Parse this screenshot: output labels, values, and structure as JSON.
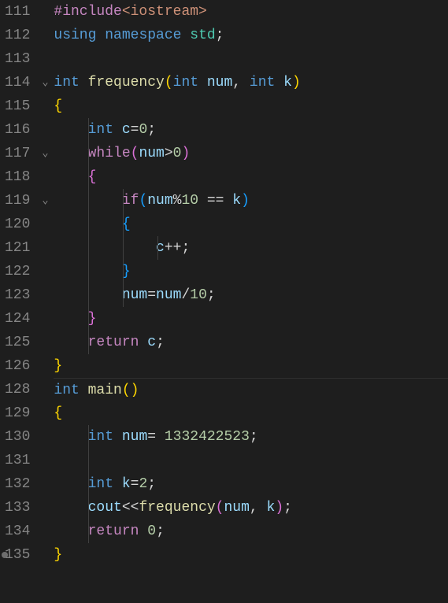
{
  "editor": {
    "language": "cpp",
    "colors": {
      "background": "#1e1e1e",
      "gutter_fg": "#858585",
      "default_fg": "#d4d4d4",
      "keyword": "#569cd6",
      "control": "#c586c0",
      "function": "#dcdcaa",
      "identifier": "#9cdcfe",
      "number": "#b5cea8",
      "type_namespace": "#4ec9b0",
      "bracket1": "#ffd700",
      "bracket2": "#da70d6",
      "bracket3": "#179fff"
    },
    "fold_markers": {
      "114": "v",
      "117": "v",
      "119": "v"
    },
    "breakpoint_hint_line": 135,
    "lines": [
      {
        "num": "111",
        "indent_guides": [],
        "tokens": [
          {
            "t": "#include",
            "c": "tk-pp"
          },
          {
            "t": "<iostream>",
            "c": "tk-str"
          }
        ]
      },
      {
        "num": "112",
        "indent_guides": [],
        "tokens": [
          {
            "t": "using",
            "c": "tk-kw"
          },
          {
            "t": " ",
            "c": "tk-wht"
          },
          {
            "t": "namespace",
            "c": "tk-kw"
          },
          {
            "t": " ",
            "c": "tk-wht"
          },
          {
            "t": "std",
            "c": "tk-ns"
          },
          {
            "t": ";",
            "c": "tk-pun"
          }
        ]
      },
      {
        "num": "113",
        "indent_guides": [],
        "tokens": []
      },
      {
        "num": "114",
        "indent_guides": [],
        "tokens": [
          {
            "t": "int",
            "c": "tk-ty"
          },
          {
            "t": " ",
            "c": "tk-wht"
          },
          {
            "t": "frequency",
            "c": "tk-fn"
          },
          {
            "t": "(",
            "c": "tk-brk"
          },
          {
            "t": "int",
            "c": "tk-ty"
          },
          {
            "t": " ",
            "c": "tk-wht"
          },
          {
            "t": "num",
            "c": "tk-id"
          },
          {
            "t": ",",
            "c": "tk-pun"
          },
          {
            "t": " ",
            "c": "tk-wht"
          },
          {
            "t": "int",
            "c": "tk-ty"
          },
          {
            "t": " ",
            "c": "tk-wht"
          },
          {
            "t": "k",
            "c": "tk-id"
          },
          {
            "t": ")",
            "c": "tk-brk"
          }
        ]
      },
      {
        "num": "115",
        "indent_guides": [],
        "tokens": [
          {
            "t": "{",
            "c": "tk-brk"
          }
        ]
      },
      {
        "num": "116",
        "indent_guides": [
          1
        ],
        "tokens": [
          {
            "t": "    ",
            "c": "tk-wht"
          },
          {
            "t": "int",
            "c": "tk-ty"
          },
          {
            "t": " ",
            "c": "tk-wht"
          },
          {
            "t": "c",
            "c": "tk-id"
          },
          {
            "t": "=",
            "c": "tk-op"
          },
          {
            "t": "0",
            "c": "tk-num"
          },
          {
            "t": ";",
            "c": "tk-pun"
          }
        ]
      },
      {
        "num": "117",
        "indent_guides": [
          1
        ],
        "tokens": [
          {
            "t": "    ",
            "c": "tk-wht"
          },
          {
            "t": "while",
            "c": "tk-pp"
          },
          {
            "t": "(",
            "c": "tk-brk2"
          },
          {
            "t": "num",
            "c": "tk-id"
          },
          {
            "t": ">",
            "c": "tk-op"
          },
          {
            "t": "0",
            "c": "tk-num"
          },
          {
            "t": ")",
            "c": "tk-brk2"
          }
        ]
      },
      {
        "num": "118",
        "indent_guides": [
          1
        ],
        "tokens": [
          {
            "t": "    ",
            "c": "tk-wht"
          },
          {
            "t": "{",
            "c": "tk-brk2"
          }
        ]
      },
      {
        "num": "119",
        "indent_guides": [
          1,
          2
        ],
        "tokens": [
          {
            "t": "        ",
            "c": "tk-wht"
          },
          {
            "t": "if",
            "c": "tk-pp"
          },
          {
            "t": "(",
            "c": "tk-brk3"
          },
          {
            "t": "num",
            "c": "tk-id"
          },
          {
            "t": "%",
            "c": "tk-op"
          },
          {
            "t": "10",
            "c": "tk-num"
          },
          {
            "t": " == ",
            "c": "tk-op"
          },
          {
            "t": "k",
            "c": "tk-id"
          },
          {
            "t": ")",
            "c": "tk-brk3"
          }
        ]
      },
      {
        "num": "120",
        "indent_guides": [
          1,
          2
        ],
        "tokens": [
          {
            "t": "        ",
            "c": "tk-wht"
          },
          {
            "t": "{",
            "c": "tk-brk3"
          }
        ]
      },
      {
        "num": "121",
        "indent_guides": [
          1,
          2,
          3
        ],
        "tokens": [
          {
            "t": "            ",
            "c": "tk-wht"
          },
          {
            "t": "c",
            "c": "tk-id"
          },
          {
            "t": "++",
            "c": "tk-op"
          },
          {
            "t": ";",
            "c": "tk-pun"
          }
        ]
      },
      {
        "num": "122",
        "indent_guides": [
          1,
          2
        ],
        "tokens": [
          {
            "t": "        ",
            "c": "tk-wht"
          },
          {
            "t": "}",
            "c": "tk-brk3"
          }
        ]
      },
      {
        "num": "123",
        "indent_guides": [
          1,
          2
        ],
        "tokens": [
          {
            "t": "        ",
            "c": "tk-wht"
          },
          {
            "t": "num",
            "c": "tk-id"
          },
          {
            "t": "=",
            "c": "tk-op"
          },
          {
            "t": "num",
            "c": "tk-id"
          },
          {
            "t": "/",
            "c": "tk-op"
          },
          {
            "t": "10",
            "c": "tk-num"
          },
          {
            "t": ";",
            "c": "tk-pun"
          }
        ]
      },
      {
        "num": "124",
        "indent_guides": [
          1
        ],
        "tokens": [
          {
            "t": "    ",
            "c": "tk-wht"
          },
          {
            "t": "}",
            "c": "tk-brk2"
          }
        ]
      },
      {
        "num": "125",
        "indent_guides": [
          1
        ],
        "tokens": [
          {
            "t": "    ",
            "c": "tk-wht"
          },
          {
            "t": "return",
            "c": "tk-pp"
          },
          {
            "t": " ",
            "c": "tk-wht"
          },
          {
            "t": "c",
            "c": "tk-id"
          },
          {
            "t": ";",
            "c": "tk-pun"
          }
        ]
      },
      {
        "num": "126",
        "indent_guides": [],
        "tokens": [
          {
            "t": "}",
            "c": "tk-brk"
          }
        ]
      },
      {
        "num": "128",
        "divider": true,
        "indent_guides": [],
        "tokens": [
          {
            "t": "int",
            "c": "tk-ty"
          },
          {
            "t": " ",
            "c": "tk-wht"
          },
          {
            "t": "main",
            "c": "tk-fn"
          },
          {
            "t": "(",
            "c": "tk-brk"
          },
          {
            "t": ")",
            "c": "tk-brk"
          }
        ]
      },
      {
        "num": "129",
        "indent_guides": [],
        "tokens": [
          {
            "t": "{",
            "c": "tk-brk"
          }
        ]
      },
      {
        "num": "130",
        "indent_guides": [
          1
        ],
        "tokens": [
          {
            "t": "    ",
            "c": "tk-wht"
          },
          {
            "t": "int",
            "c": "tk-ty"
          },
          {
            "t": " ",
            "c": "tk-wht"
          },
          {
            "t": "num",
            "c": "tk-id"
          },
          {
            "t": "= ",
            "c": "tk-op"
          },
          {
            "t": "1332422523",
            "c": "tk-num"
          },
          {
            "t": ";",
            "c": "tk-pun"
          }
        ]
      },
      {
        "num": "131",
        "indent_guides": [
          1
        ],
        "tokens": []
      },
      {
        "num": "132",
        "indent_guides": [
          1
        ],
        "tokens": [
          {
            "t": "    ",
            "c": "tk-wht"
          },
          {
            "t": "int",
            "c": "tk-ty"
          },
          {
            "t": " ",
            "c": "tk-wht"
          },
          {
            "t": "k",
            "c": "tk-id"
          },
          {
            "t": "=",
            "c": "tk-op"
          },
          {
            "t": "2",
            "c": "tk-num"
          },
          {
            "t": ";",
            "c": "tk-pun"
          }
        ]
      },
      {
        "num": "133",
        "indent_guides": [
          1
        ],
        "tokens": [
          {
            "t": "    ",
            "c": "tk-wht"
          },
          {
            "t": "cout",
            "c": "tk-id"
          },
          {
            "t": "<<",
            "c": "tk-op"
          },
          {
            "t": "frequency",
            "c": "tk-fn"
          },
          {
            "t": "(",
            "c": "tk-brk2"
          },
          {
            "t": "num",
            "c": "tk-id"
          },
          {
            "t": ",",
            "c": "tk-pun"
          },
          {
            "t": " ",
            "c": "tk-wht"
          },
          {
            "t": "k",
            "c": "tk-id"
          },
          {
            "t": ")",
            "c": "tk-brk2"
          },
          {
            "t": ";",
            "c": "tk-pun"
          }
        ]
      },
      {
        "num": "134",
        "indent_guides": [
          1
        ],
        "tokens": [
          {
            "t": "    ",
            "c": "tk-wht"
          },
          {
            "t": "return",
            "c": "tk-pp"
          },
          {
            "t": " ",
            "c": "tk-wht"
          },
          {
            "t": "0",
            "c": "tk-num"
          },
          {
            "t": ";",
            "c": "tk-pun"
          }
        ]
      },
      {
        "num": "135",
        "indent_guides": [],
        "tokens": [
          {
            "t": "}",
            "c": "tk-brk"
          }
        ]
      }
    ]
  }
}
